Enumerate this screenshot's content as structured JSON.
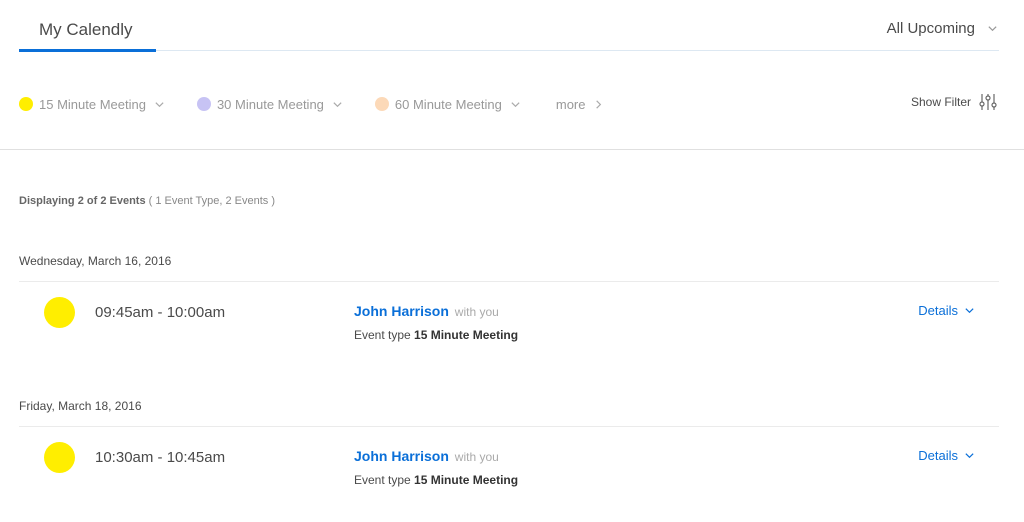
{
  "header": {
    "tab_label": "My Calendly",
    "range_label": "All Upcoming"
  },
  "filters": [
    {
      "label": "15 Minute Meeting",
      "color": "#ffee00"
    },
    {
      "label": "30 Minute Meeting",
      "color": "#c7c3f4"
    },
    {
      "label": "60 Minute Meeting",
      "color": "#fcd9b8"
    }
  ],
  "more_label": "more",
  "show_filter_label": "Show Filter",
  "summary": {
    "prefix": "Displaying",
    "shown": "2",
    "of": "of",
    "total": "2 Events",
    "detail": "( 1 Event Type, 2 Events )"
  },
  "days": [
    {
      "date": "Wednesday, March 16, 2016",
      "events": [
        {
          "time": "09:45am - 10:00am",
          "name": "John Harrison",
          "with": "with you",
          "type_prefix": "Event type",
          "type": "15 Minute Meeting",
          "details_label": "Details",
          "color": "#ffee00"
        }
      ]
    },
    {
      "date": "Friday, March 18, 2016",
      "events": [
        {
          "time": "10:30am - 10:45am",
          "name": "John Harrison",
          "with": "with you",
          "type_prefix": "Event type",
          "type": "15 Minute Meeting",
          "details_label": "Details",
          "color": "#ffee00"
        }
      ]
    }
  ],
  "colors": {
    "accent": "#0a6fd8"
  }
}
